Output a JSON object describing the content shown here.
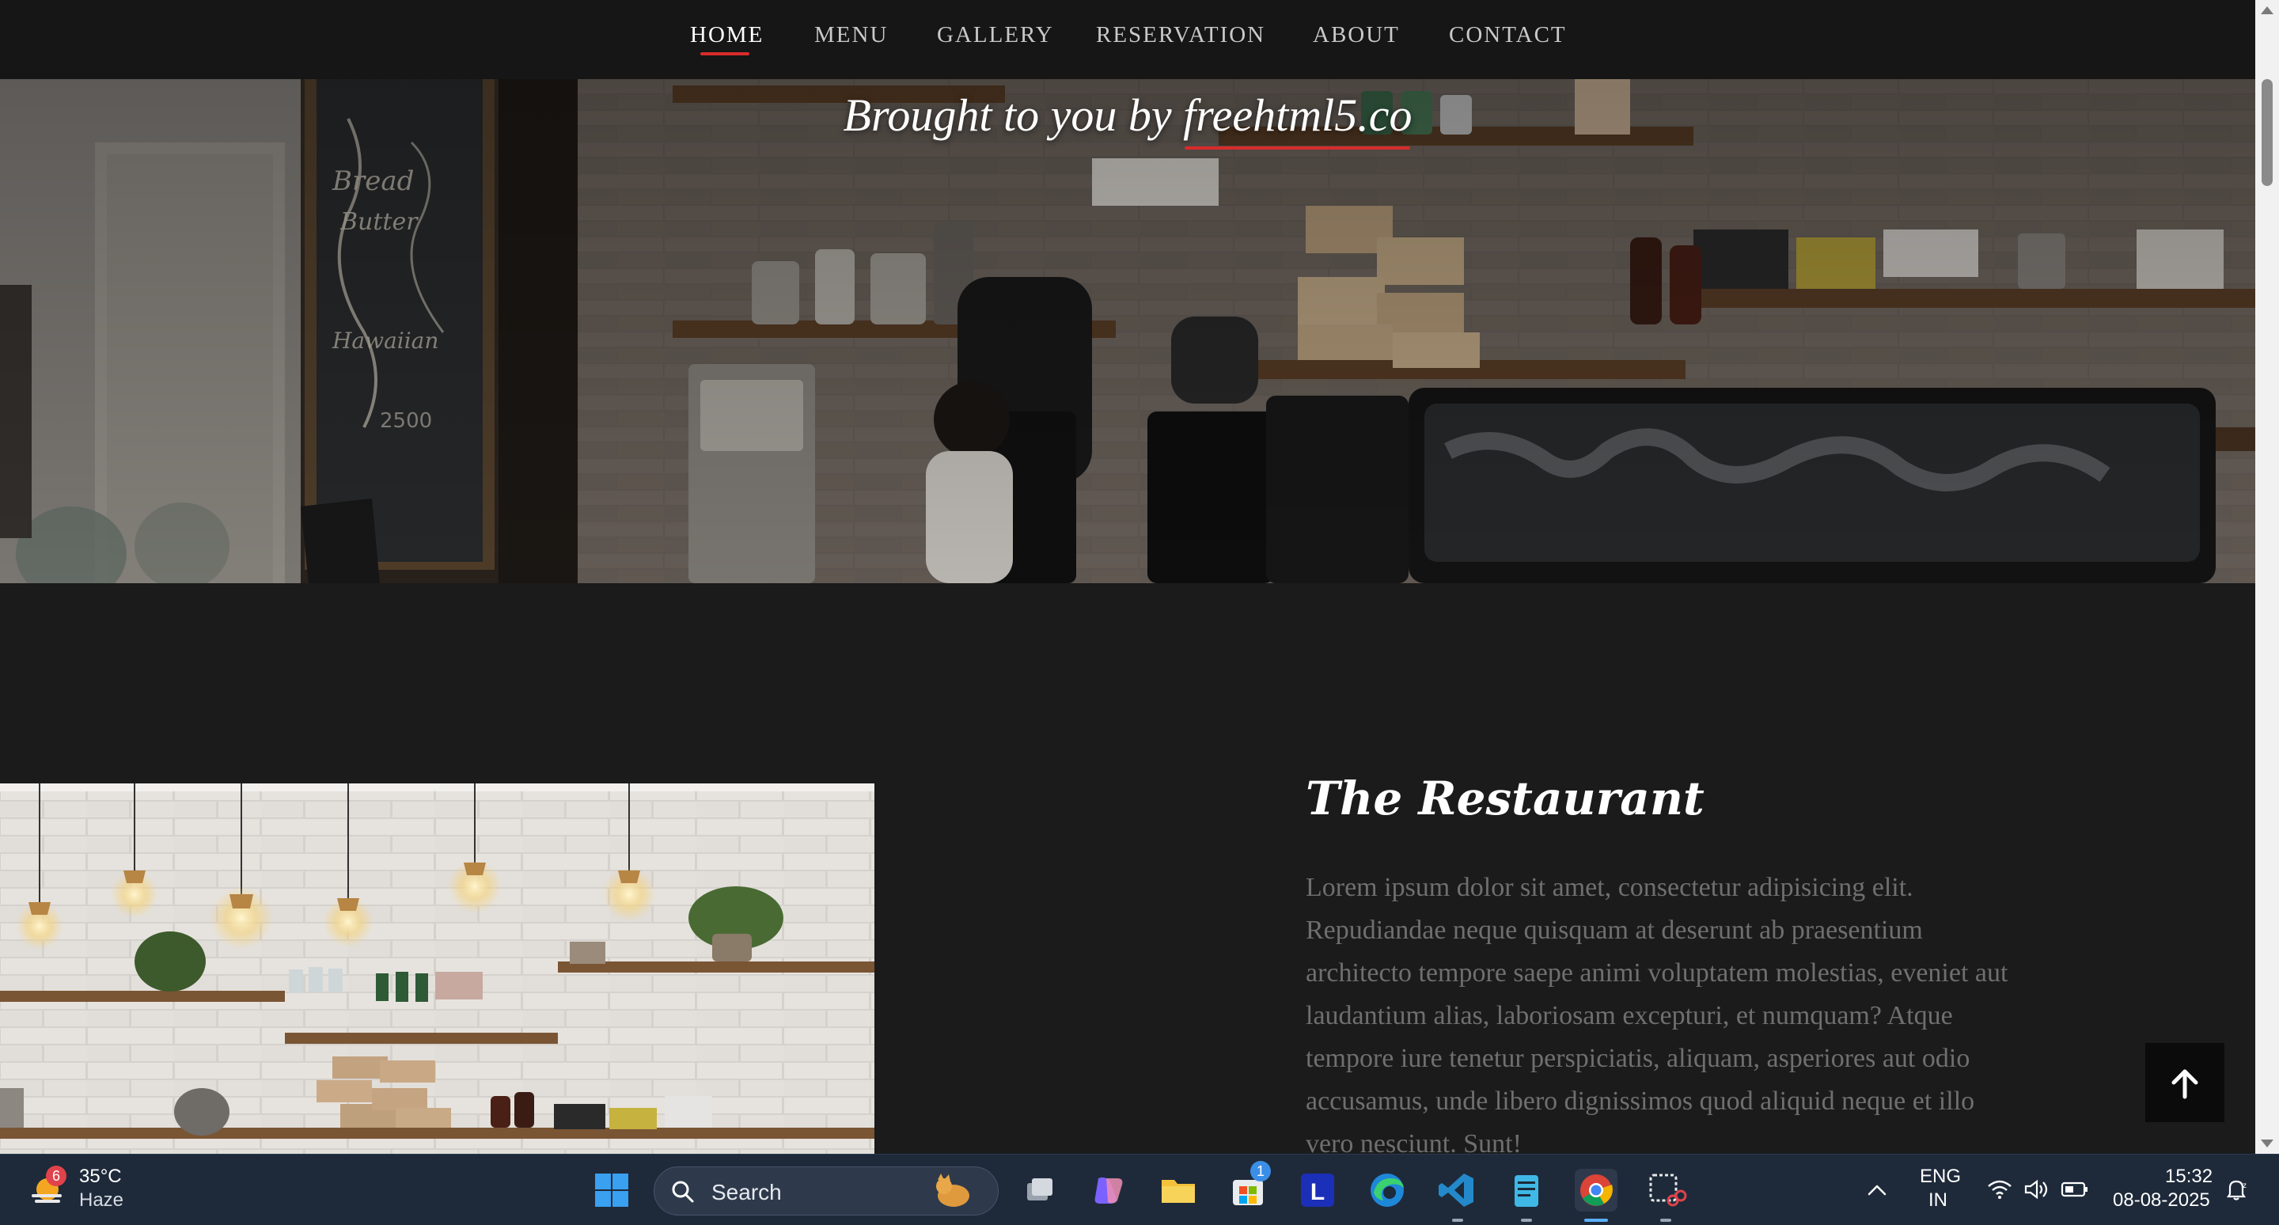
{
  "nav": {
    "items": [
      {
        "label": "HOME",
        "active": true
      },
      {
        "label": "MENU",
        "active": false
      },
      {
        "label": "GALLERY",
        "active": false
      },
      {
        "label": "RESERVATION",
        "active": false
      },
      {
        "label": "ABOUT",
        "active": false
      },
      {
        "label": "CONTACT",
        "active": false
      }
    ]
  },
  "hero": {
    "subtitle_prefix": "Brought to you by ",
    "subtitle_link": "freehtml5.co"
  },
  "restaurant": {
    "title": "The Restaurant",
    "body": "Lorem ipsum dolor sit amet, consectetur adipisicing elit. Repudiandae neque quisquam at deserunt ab praesentium architecto tempore saepe animi voluptatem molestias, eveniet aut laudantium alias, laboriosam excepturi, et numquam? Atque tempore iure tenetur perspiciatis, aliquam, asperiores aut odio accusamus, unde libero dignissimos quod aliquid neque et illo vero nesciunt. Sunt!"
  },
  "back_to_top": {
    "icon": "arrow-up-icon"
  },
  "taskbar": {
    "weather": {
      "temp": "35°C",
      "condition": "Haze",
      "badge": "6"
    },
    "search_placeholder": "Search",
    "store_badge": "1",
    "lang": {
      "line1": "ENG",
      "line2": "IN"
    },
    "clock": {
      "time": "15:32",
      "date": "08-08-2025"
    },
    "apps": [
      "start-icon",
      "task-view-icon",
      "copilot-icon",
      "file-explorer-icon",
      "microsoft-store-icon",
      "l-app-icon",
      "edge-icon",
      "vscode-icon",
      "notepad-icon",
      "chrome-icon",
      "snipping-tool-icon"
    ]
  },
  "colors": {
    "accent": "#d92b2b",
    "background": "#1b1b1b",
    "taskbar": "#1e2a3a"
  }
}
